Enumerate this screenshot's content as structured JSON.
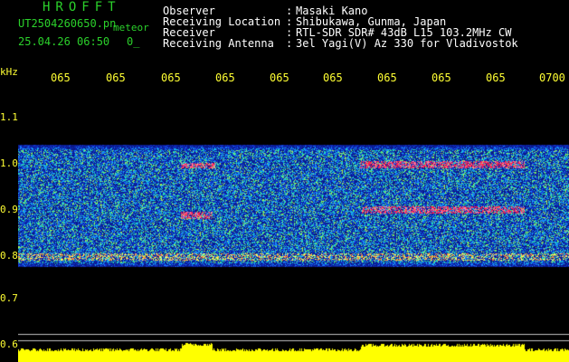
{
  "header": {
    "app_title": "HROFFT",
    "file_name": "UT2504260650.pn",
    "meteor_tag": "meteor",
    "datetime": "25.04.26 06:50",
    "count": "0_"
  },
  "station": [
    {
      "label": "Observer",
      "value": "Masaki Kano"
    },
    {
      "label": "Receiving Location",
      "value": "Shibukawa, Gunma, Japan"
    },
    {
      "label": "Receiver",
      "value": "RTL-SDR SDR# 43dB L15 103.2MHz CW"
    },
    {
      "label": "Receiving Antenna",
      "value": "3el Yagi(V) Az 330 for Vladivostok"
    }
  ],
  "axes": {
    "y_unit": "kHz",
    "y_ticks": [
      "1.1",
      "1.0",
      "0.9",
      "0.8",
      "0.7",
      "0.6"
    ],
    "x_ticks": [
      "065",
      "065",
      "065",
      "065",
      "065",
      "065",
      "065",
      "065",
      "065",
      "0700"
    ]
  },
  "colors": {
    "background": "#000000",
    "header_text": "#ffffff",
    "title_text": "#2bd12b",
    "axis_text": "#ffff33",
    "power_trace": "#ffff00"
  }
}
